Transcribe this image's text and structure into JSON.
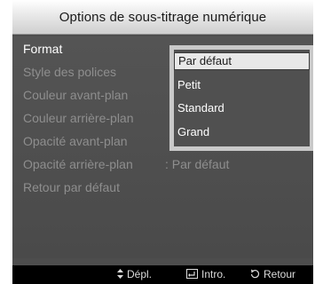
{
  "title": "Options de sous-titrage numérique",
  "menu": {
    "items": [
      {
        "label": "Format",
        "value": ""
      },
      {
        "label": "Style des polices",
        "value": ""
      },
      {
        "label": "Couleur avant-plan",
        "value": ""
      },
      {
        "label": "Couleur arrière-plan",
        "value": ""
      },
      {
        "label": "Opacité avant-plan",
        "value": ""
      },
      {
        "label": "Opacité arrière-plan",
        "value": ": Par défaut"
      },
      {
        "label": "Retour par défaut",
        "value": ""
      }
    ],
    "active_index": 0
  },
  "dropdown": {
    "options": [
      "Par défaut",
      "Petit",
      "Standard",
      "Grand"
    ],
    "selected_index": 0
  },
  "footer": {
    "move": {
      "icon": "up-down-arrow-icon",
      "label": "Dépl."
    },
    "enter": {
      "icon": "enter-icon",
      "label": "Intro."
    },
    "return": {
      "icon": "return-icon",
      "label": "Retour"
    }
  },
  "colors": {
    "panel_bg": "#4d4d4d",
    "title_bg": "#e6e6e6",
    "active_text": "#ffffff",
    "inactive_text": "#8e8e8e",
    "dropdown_frame": "#c9c9c9",
    "dropdown_selected_bg": "#e8e8e8",
    "footer_bg": "#000000"
  }
}
